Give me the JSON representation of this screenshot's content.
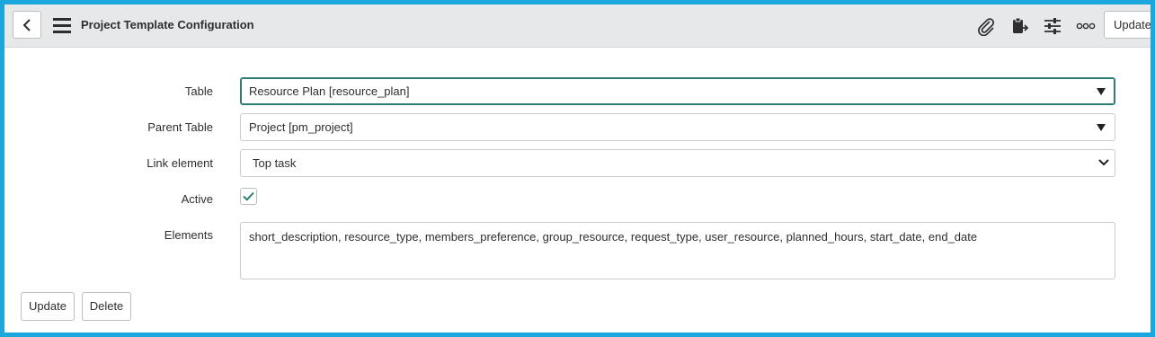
{
  "header": {
    "title": "Project Template Configuration",
    "update_label": "Update",
    "icons": [
      "back-icon",
      "menu-icon",
      "attachment-icon",
      "clipboard-icon",
      "settings-sliders-icon",
      "more-icon"
    ]
  },
  "form": {
    "table": {
      "label": "Table",
      "value": "Resource Plan [resource_plan]"
    },
    "parent_table": {
      "label": "Parent Table",
      "value": "Project [pm_project]"
    },
    "link_element": {
      "label": "Link element",
      "value": "Top task"
    },
    "active": {
      "label": "Active",
      "checked": true
    },
    "elements": {
      "label": "Elements",
      "value": "short_description, resource_type, members_preference, group_resource, request_type, user_resource, planned_hours, start_date, end_date"
    }
  },
  "footer": {
    "update_label": "Update",
    "delete_label": "Delete"
  },
  "colors": {
    "frame_border": "#1ba6dc",
    "header_bg": "#e6e8ea",
    "focus_border": "#2b7d73",
    "check": "#2b7d73"
  }
}
